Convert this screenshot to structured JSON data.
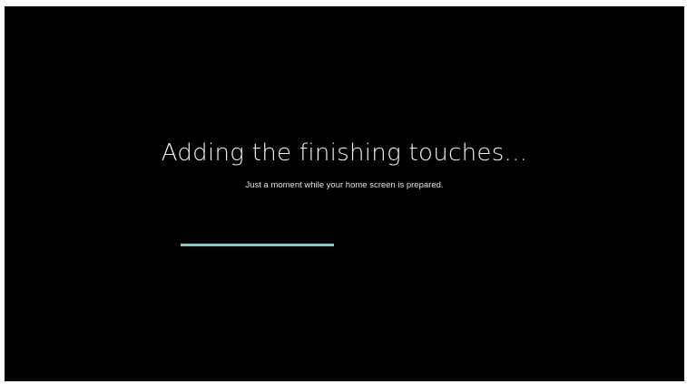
{
  "setup_screen": {
    "title": "Adding the finishing touches...",
    "subtitle": "Just a moment while your home screen is prepared.",
    "progress": {
      "fraction": 0.47,
      "color": "#80cbc4"
    }
  }
}
